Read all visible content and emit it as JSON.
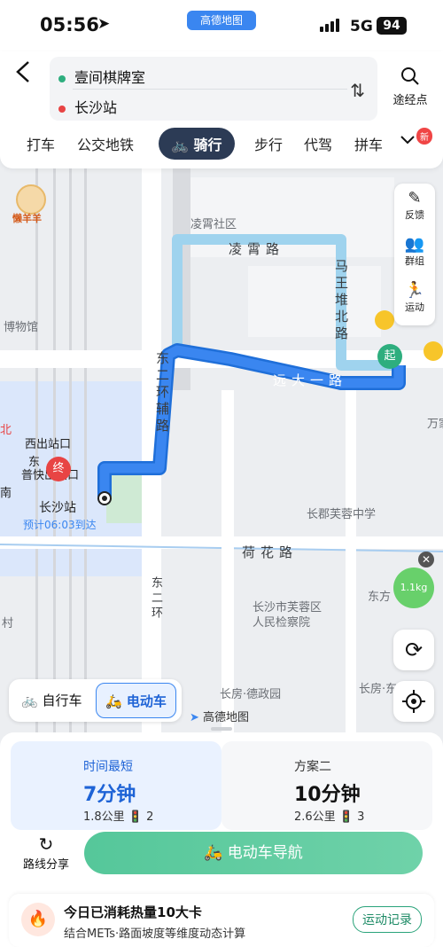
{
  "status_bar": {
    "time": "05:56",
    "app_pill": "高德地图",
    "network": "5G",
    "battery": "94"
  },
  "route": {
    "origin": "壹间棋牌室",
    "destination": "长沙站",
    "waypoint_label": "途经点"
  },
  "mode_tabs": [
    "打车",
    "公交地铁",
    "骑行",
    "步行",
    "代驾",
    "拼车"
  ],
  "active_tab": "骑行",
  "new_badge": "新",
  "map": {
    "poi_labels": [
      "凌霄社区",
      "博物馆",
      "长沙站",
      "西出站口",
      "东",
      "普快出站口",
      "预计06:03到达",
      "长郡芙蓉中学",
      "长沙市芙蓉区",
      "人民检察院",
      "长房·德政园",
      "长房·东",
      "东方",
      "万家",
      "村",
      "南",
      "北"
    ],
    "road_labels": [
      "凌霄路",
      "马王堆北路",
      "远大一路",
      "东二环辅路",
      "荷花路",
      "东二环"
    ],
    "brand": "高德地图",
    "mascot": "懒羊羊",
    "start_marker": "起",
    "end_marker": "终",
    "kg_bubble": "1.1kg"
  },
  "tools": [
    {
      "label": "反馈",
      "icon": "pencil-icon"
    },
    {
      "label": "群组",
      "icon": "group-icon"
    },
    {
      "label": "运动",
      "icon": "run-icon"
    }
  ],
  "vehicle": {
    "bike": "自行车",
    "ebike": "电动车"
  },
  "plans": [
    {
      "tag": "时间最短",
      "duration": "7分钟",
      "distance": "1.8公里",
      "lights": "2"
    },
    {
      "tag": "方案二",
      "duration": "10分钟",
      "distance": "2.6公里",
      "lights": "3"
    }
  ],
  "actions": {
    "share": "路线分享",
    "navigate": "电动车导航"
  },
  "calorie_card": {
    "title": "今日已消耗热量10大卡",
    "subtitle": "结合METs·路面坡度等维度动态计算",
    "button": "运动记录"
  },
  "colors": {
    "route": "#3a86f0",
    "route_alt": "#9fd3ee",
    "nav": "#5ac99d"
  }
}
